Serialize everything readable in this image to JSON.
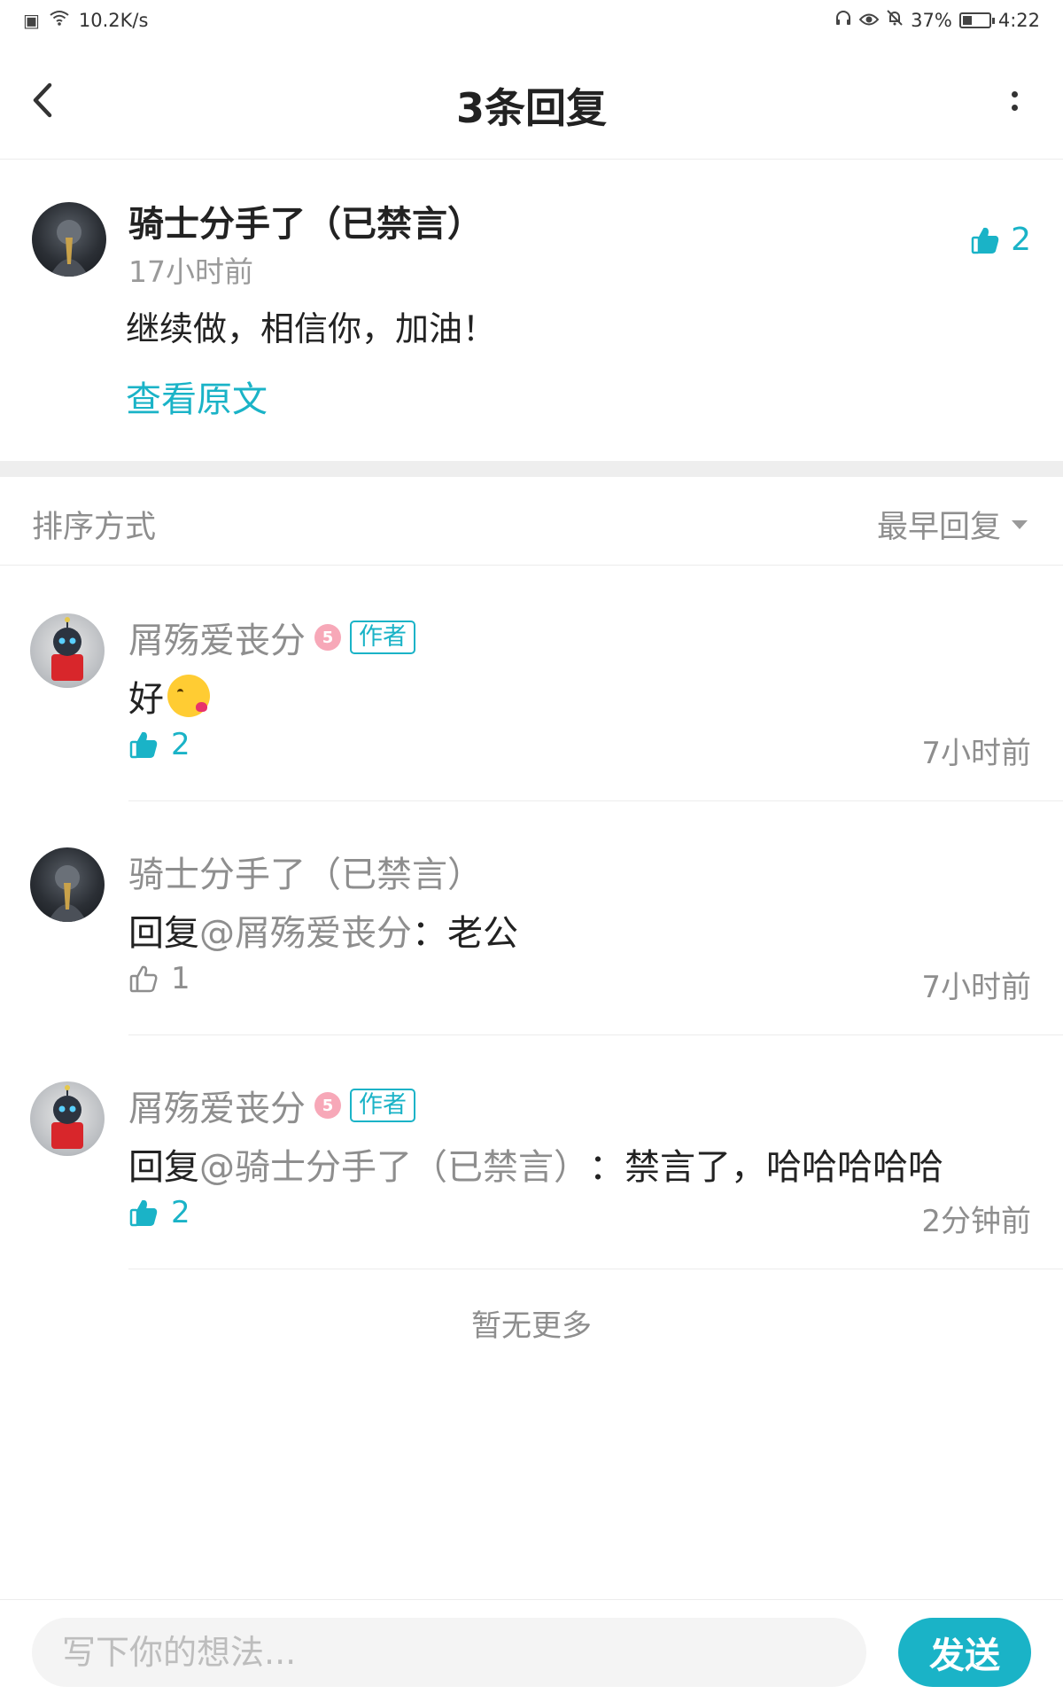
{
  "status_bar": {
    "speed": "10.2K/s",
    "battery_percent": "37%",
    "battery_level": 0.37,
    "time": "4:22"
  },
  "header": {
    "title": "3条回复"
  },
  "main_comment": {
    "author": "骑士分手了（已禁言）",
    "time": "17小时前",
    "text": "继续做，相信你，加油！",
    "view_original": "查看原文",
    "likes": "2"
  },
  "sort": {
    "label": "排序方式",
    "selected": "最早回复"
  },
  "replies": [
    {
      "author": "屑殇爱丧分",
      "level": "5",
      "tag": "作者",
      "text": "好",
      "likes": "2",
      "time": "7小时前"
    },
    {
      "author": "骑士分手了（已禁言）",
      "prefix": "回复",
      "mention": "@屑殇爱丧分",
      "text": "：老公",
      "likes": "1",
      "time": "7小时前"
    },
    {
      "author": "屑殇爱丧分",
      "level": "5",
      "tag": "作者",
      "prefix": "回复",
      "mention": "@骑士分手了（已禁言）",
      "text": "：禁言了，哈哈哈哈哈",
      "likes": "2",
      "time": "2分钟前"
    }
  ],
  "footer_note": "暂无更多",
  "composer": {
    "placeholder": "写下你的想法...",
    "send_label": "发送"
  },
  "colors": {
    "accent": "#1ab3c7",
    "muted": "#8e8e8e",
    "badge": "#f7a8b8"
  }
}
